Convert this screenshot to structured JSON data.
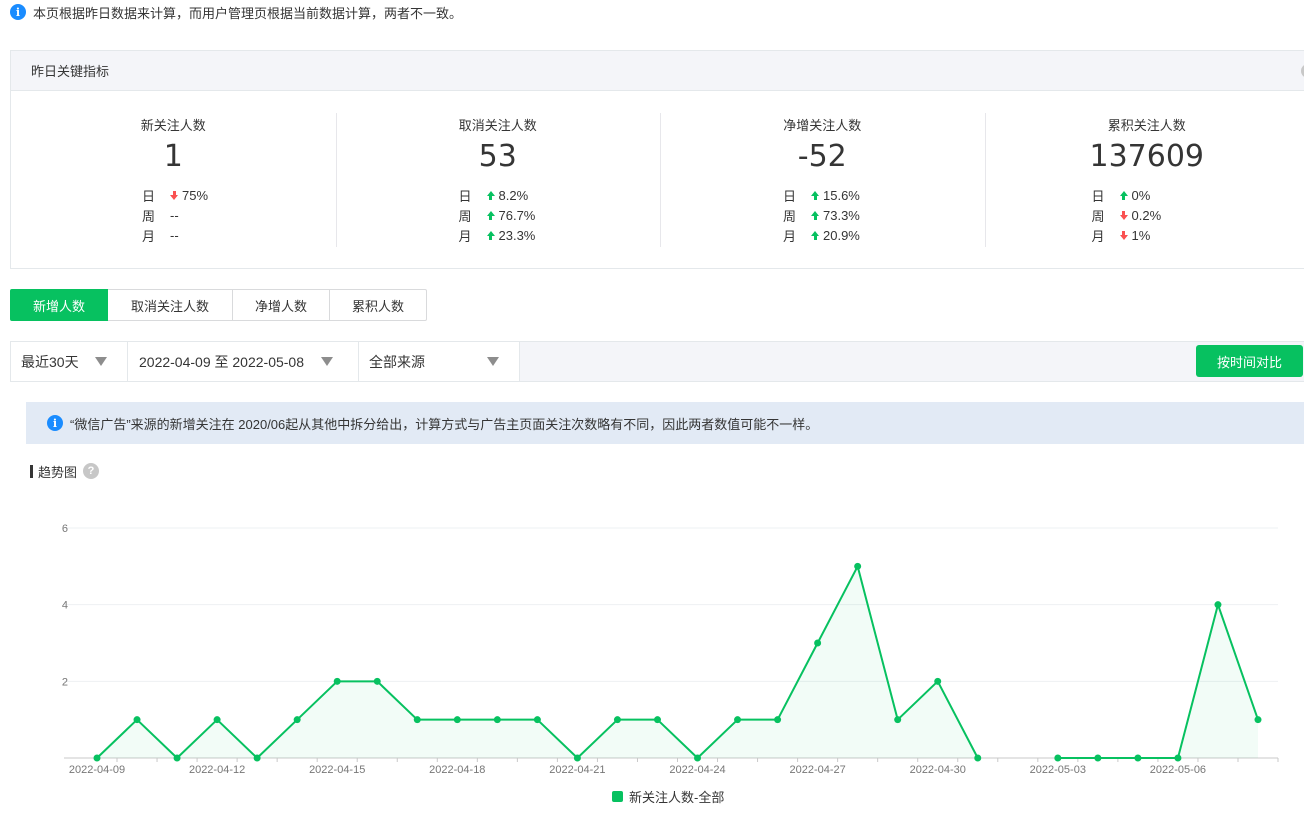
{
  "notice_top": "本页根据昨日数据来计算，而用户管理页根据当前数据计算，两者不一致。",
  "kpi": {
    "title": "昨日关键指标",
    "cards": [
      {
        "title": "新关注人数",
        "value": "1",
        "changes": [
          {
            "period": "日",
            "dir": "down",
            "pct": "75%"
          },
          {
            "period": "周",
            "dir": "none",
            "pct": "--"
          },
          {
            "period": "月",
            "dir": "none",
            "pct": "--"
          }
        ]
      },
      {
        "title": "取消关注人数",
        "value": "53",
        "changes": [
          {
            "period": "日",
            "dir": "up",
            "pct": "8.2%"
          },
          {
            "period": "周",
            "dir": "up",
            "pct": "76.7%"
          },
          {
            "period": "月",
            "dir": "up",
            "pct": "23.3%"
          }
        ]
      },
      {
        "title": "净增关注人数",
        "value": "-52",
        "changes": [
          {
            "period": "日",
            "dir": "up",
            "pct": "15.6%"
          },
          {
            "period": "周",
            "dir": "up",
            "pct": "73.3%"
          },
          {
            "period": "月",
            "dir": "up",
            "pct": "20.9%"
          }
        ]
      },
      {
        "title": "累积关注人数",
        "value": "137609",
        "changes": [
          {
            "period": "日",
            "dir": "up",
            "pct": "0%"
          },
          {
            "period": "周",
            "dir": "down",
            "pct": "0.2%"
          },
          {
            "period": "月",
            "dir": "down",
            "pct": "1%"
          }
        ]
      }
    ]
  },
  "tabs": [
    {
      "label": "新增人数",
      "active": true
    },
    {
      "label": "取消关注人数",
      "active": false
    },
    {
      "label": "净增人数",
      "active": false
    },
    {
      "label": "累积人数",
      "active": false
    }
  ],
  "filters": {
    "range": "最近30天",
    "dates": "2022-04-09 至 2022-05-08",
    "source": "全部来源",
    "compare_button": "按时间对比"
  },
  "notice_box": "“微信广告”来源的新增关注在 2020/06起从其他中拆分给出，计算方式与广告主页面关注次数略有不同，因此两者数值可能不一样。",
  "trend_title": "趋势图",
  "accent_color": "#07c160",
  "chart_data": {
    "type": "area",
    "ylim": [
      0,
      6
    ],
    "y_ticks": [
      2,
      4,
      6
    ],
    "x": [
      "2022-04-09",
      "2022-04-10",
      "2022-04-11",
      "2022-04-12",
      "2022-04-13",
      "2022-04-14",
      "2022-04-15",
      "2022-04-16",
      "2022-04-17",
      "2022-04-18",
      "2022-04-19",
      "2022-04-20",
      "2022-04-21",
      "2022-04-22",
      "2022-04-23",
      "2022-04-24",
      "2022-04-25",
      "2022-04-26",
      "2022-04-27",
      "2022-04-28",
      "2022-04-29",
      "2022-04-30",
      "2022-05-01",
      "2022-05-02",
      "2022-05-03",
      "2022-05-04",
      "2022-05-05",
      "2022-05-06",
      "2022-05-07",
      "2022-05-08"
    ],
    "x_tick_labels": [
      "2022-04-09",
      "2022-04-12",
      "2022-04-15",
      "2022-04-18",
      "2022-04-21",
      "2022-04-24",
      "2022-04-27",
      "2022-04-30",
      "2022-05-03",
      "2022-05-06"
    ],
    "series": [
      {
        "name": "新关注人数-全部",
        "values": [
          0,
          1,
          0,
          1,
          0,
          1,
          2,
          2,
          1,
          1,
          1,
          1,
          0,
          1,
          1,
          0,
          1,
          1,
          3,
          5,
          1,
          2,
          0,
          null,
          0,
          0,
          0,
          0,
          4,
          1
        ]
      }
    ],
    "legend": "bottom-center",
    "grid": true
  }
}
